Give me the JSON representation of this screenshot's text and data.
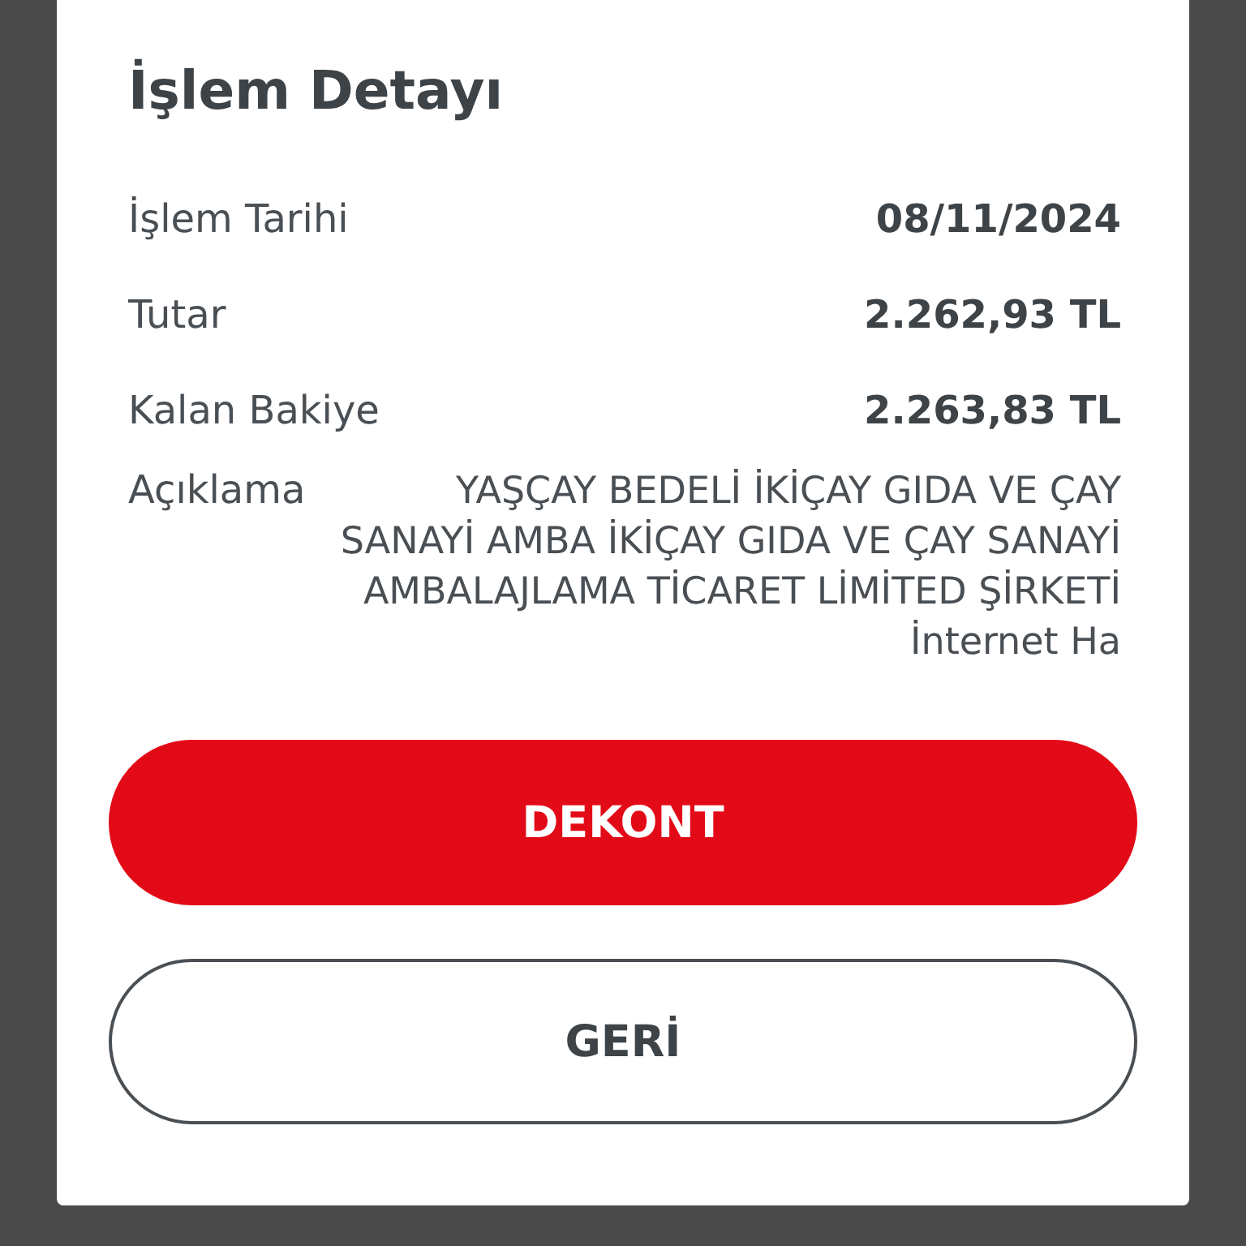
{
  "dialog": {
    "title": "İşlem Detayı",
    "rows": [
      {
        "label": "İşlem Tarihi",
        "value": "08/11/2024"
      },
      {
        "label": "Tutar",
        "value": "2.262,93 TL"
      },
      {
        "label": "Kalan Bakiye",
        "value": "2.263,83 TL"
      }
    ],
    "description": {
      "label": "Açıklama",
      "value": "YAŞÇAY BEDELİ İKİÇAY GIDA VE ÇAY SANAYİ AMBA İKİÇAY GIDA VE ÇAY SANAYİ AMBALAJLAMA TİCARET LİMİTED ŞİRKETİ İnternet Ha"
    },
    "buttons": [
      {
        "label": "DEKONT",
        "kind": "primary"
      },
      {
        "label": "GERİ",
        "kind": "outline"
      }
    ]
  }
}
